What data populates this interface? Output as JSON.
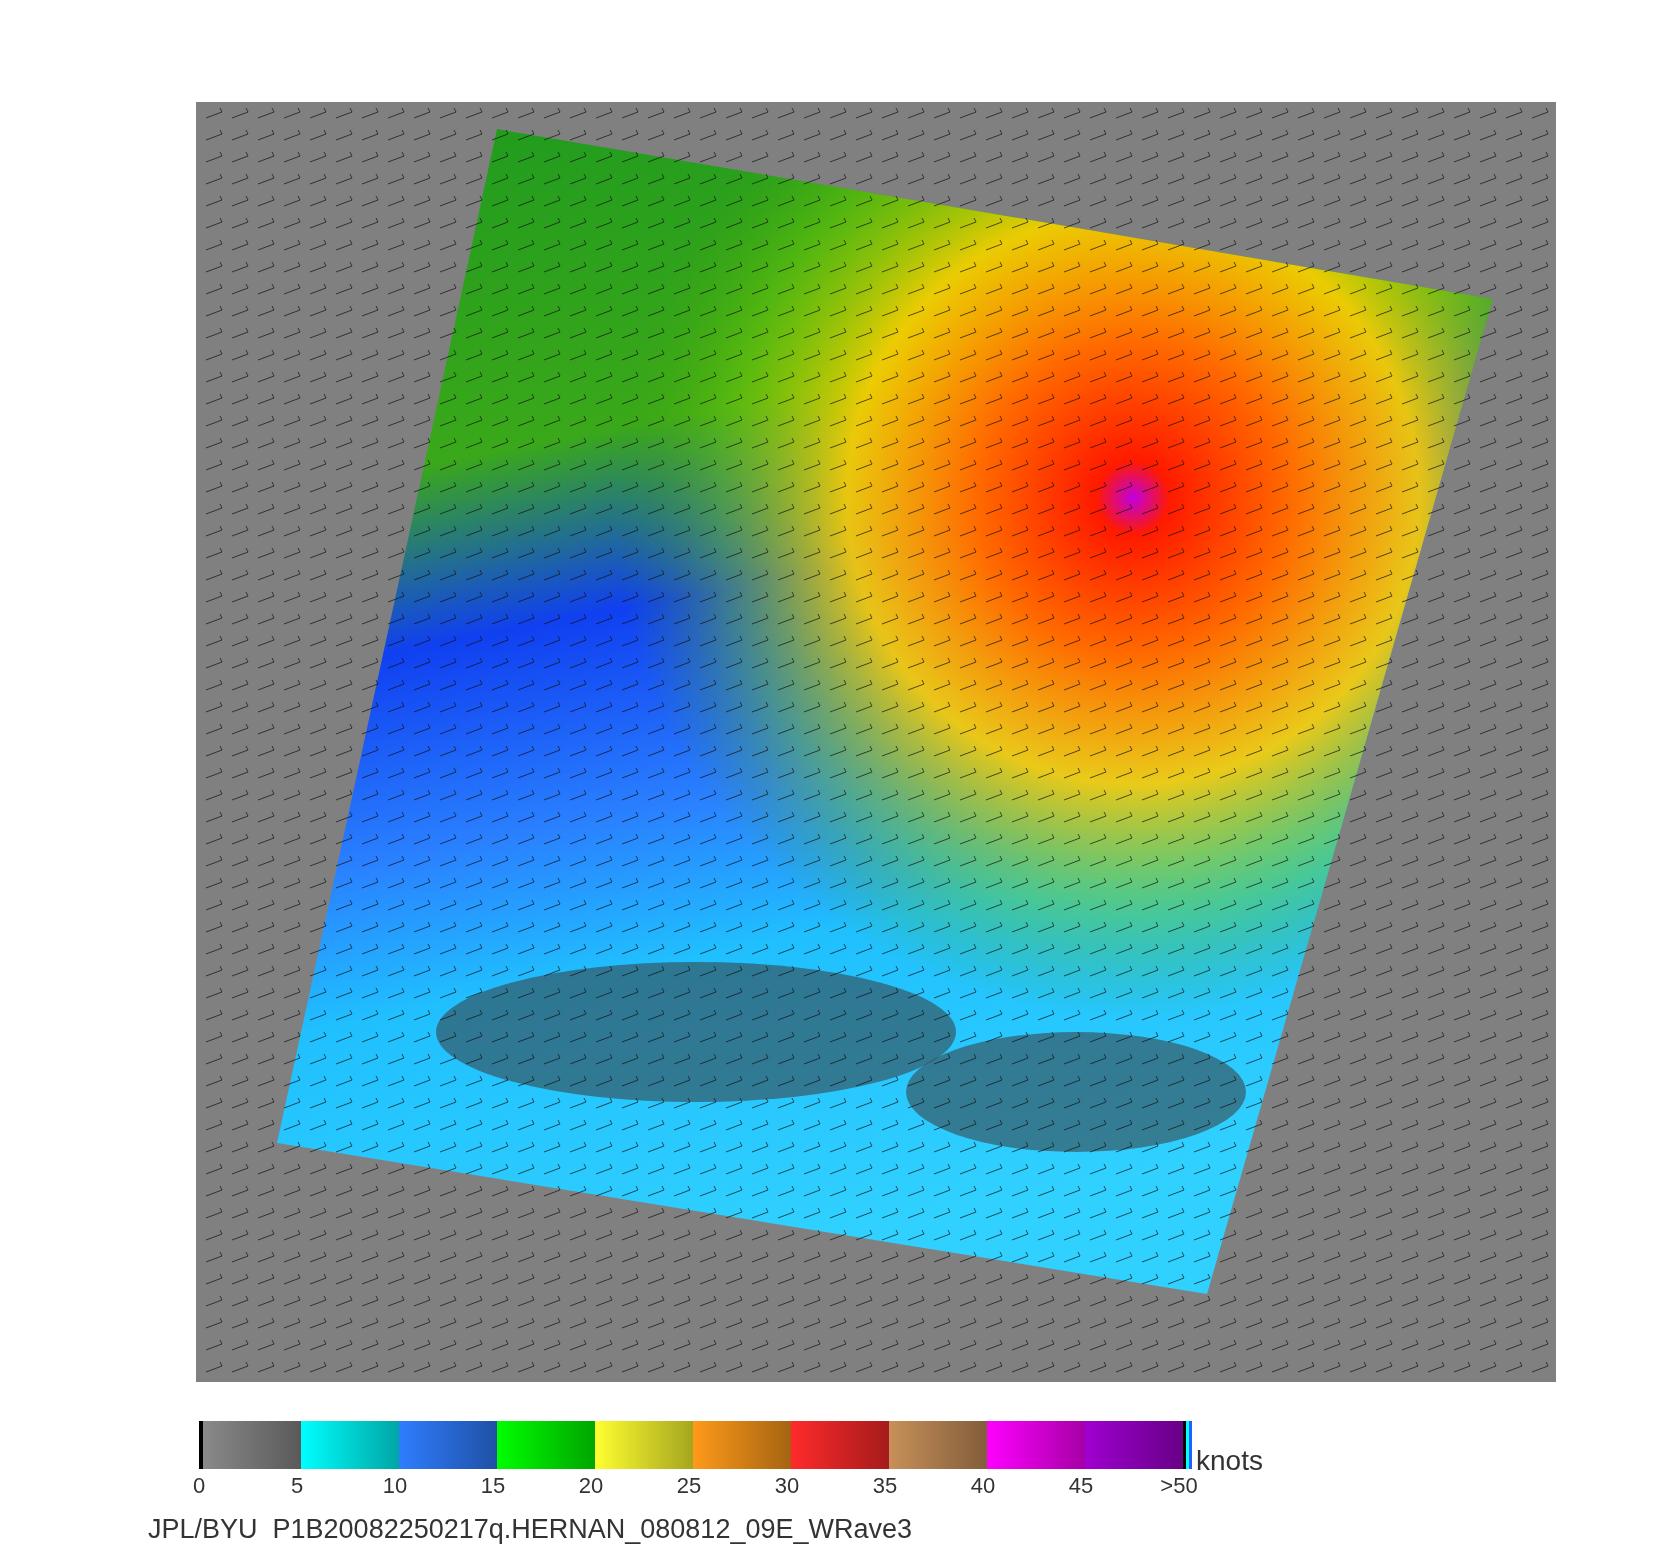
{
  "colorbar": {
    "segments": [
      {
        "color": "#8a8a8a"
      },
      {
        "color": "#00ffff"
      },
      {
        "color": "#2f7dff"
      },
      {
        "color": "#00ff00"
      },
      {
        "color": "#ffff30"
      },
      {
        "color": "#ff9a1a"
      },
      {
        "color": "#ff2a2a"
      },
      {
        "color": "#c8905a"
      },
      {
        "color": "#ff00ff"
      },
      {
        "color": "#a000d0"
      }
    ],
    "ticks": [
      "0",
      "5",
      "10",
      "15",
      "20",
      "25",
      "30",
      "35",
      "40",
      "45",
      ">50"
    ],
    "unit": "knots"
  },
  "caption": "JPL/BYU  P1B20082250217q.HERNAN_080812_09E_WRave3"
}
